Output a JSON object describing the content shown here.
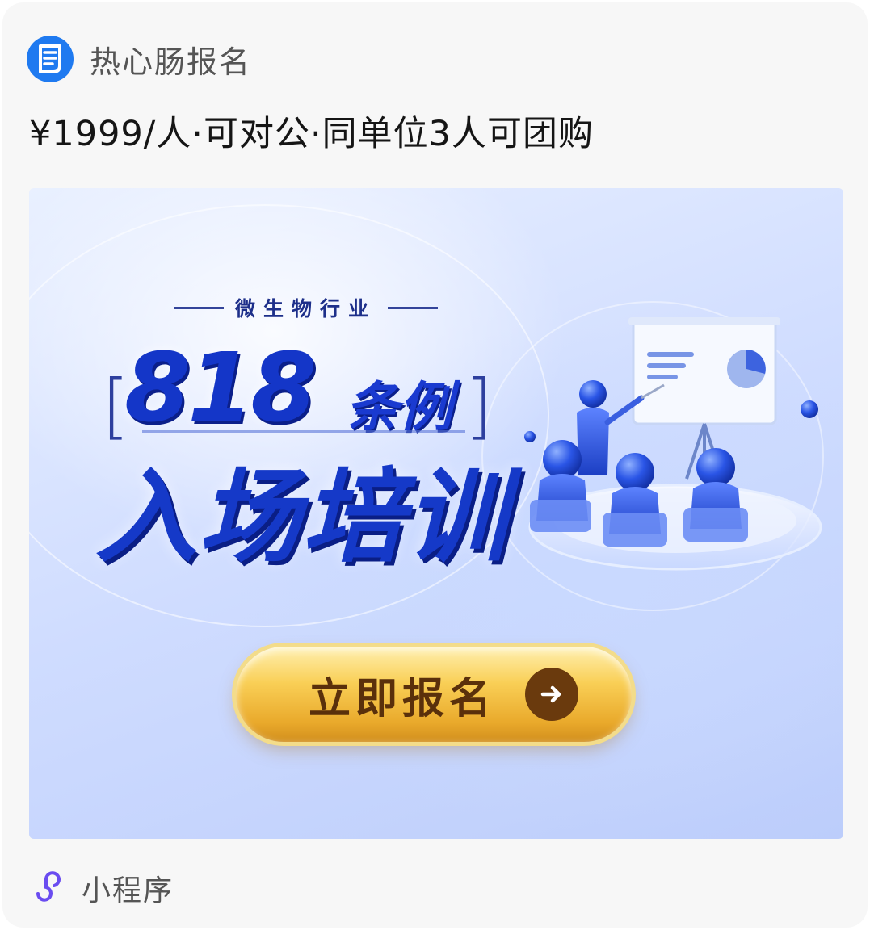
{
  "header": {
    "logo_icon": "intestine-logo-icon",
    "app_name": "热心肠报名"
  },
  "title": "¥1999/人·可对公·同单位3人可团购",
  "banner": {
    "subtitle": "微生物行业",
    "number": "818",
    "number_suffix": "条例",
    "bracket_left": "[",
    "bracket_right": "]",
    "headline": "入场培训",
    "illustration_icon": "training-presentation-icon",
    "cta": {
      "label": "立即报名",
      "icon": "arrow-right-icon"
    }
  },
  "footer": {
    "icon": "mini-program-icon",
    "label": "小程序"
  },
  "colors": {
    "card_bg": "#f7f7f7",
    "logo_blue": "#1f7af0",
    "headline_blue": "#1539c8",
    "cta_gold": "#f9cf56",
    "footer_icon": "#6a4cf0"
  }
}
